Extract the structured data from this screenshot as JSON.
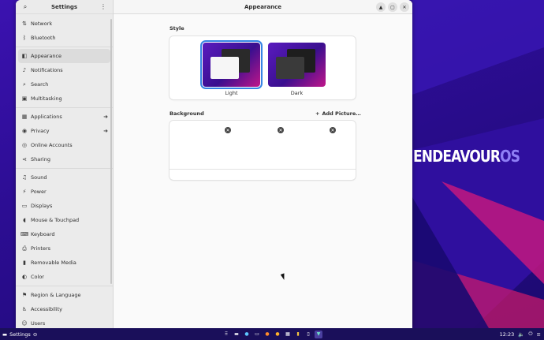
{
  "desktop": {
    "brand_main": "ENDEAVOUR",
    "brand_os": "OS"
  },
  "window": {
    "sidebar_title": "Settings",
    "content_title": "Appearance",
    "nav": [
      {
        "label": "Network",
        "icon": "network-icon"
      },
      {
        "label": "Bluetooth",
        "icon": "bluetooth-icon"
      },
      {
        "label": "Appearance",
        "icon": "appearance-icon",
        "active": true
      },
      {
        "label": "Notifications",
        "icon": "bell-icon"
      },
      {
        "label": "Search",
        "icon": "search-icon"
      },
      {
        "label": "Multitasking",
        "icon": "multitasking-icon"
      },
      {
        "label": "Applications",
        "icon": "grid-icon",
        "arrow": true
      },
      {
        "label": "Privacy",
        "icon": "hand-icon",
        "arrow": true
      },
      {
        "label": "Online Accounts",
        "icon": "accounts-icon"
      },
      {
        "label": "Sharing",
        "icon": "share-icon"
      },
      {
        "label": "Sound",
        "icon": "sound-icon"
      },
      {
        "label": "Power",
        "icon": "power-icon"
      },
      {
        "label": "Displays",
        "icon": "display-icon"
      },
      {
        "label": "Mouse & Touchpad",
        "icon": "mouse-icon"
      },
      {
        "label": "Keyboard",
        "icon": "keyboard-icon"
      },
      {
        "label": "Printers",
        "icon": "printer-icon"
      },
      {
        "label": "Removable Media",
        "icon": "media-icon"
      },
      {
        "label": "Color",
        "icon": "color-icon"
      },
      {
        "label": "Region & Language",
        "icon": "flag-icon"
      },
      {
        "label": "Accessibility",
        "icon": "accessibility-icon"
      },
      {
        "label": "Users",
        "icon": "users-icon"
      }
    ]
  },
  "appearance": {
    "style_label": "Style",
    "light_label": "Light",
    "dark_label": "Dark",
    "background_label": "Background",
    "add_picture": "Add Picture…"
  },
  "taskbar": {
    "app_label": "Settings",
    "time": "12:23"
  },
  "colors": {
    "accent": "#3584e4",
    "wallpaper": "#2c0d93",
    "taskbar": "#1a0f5a"
  }
}
